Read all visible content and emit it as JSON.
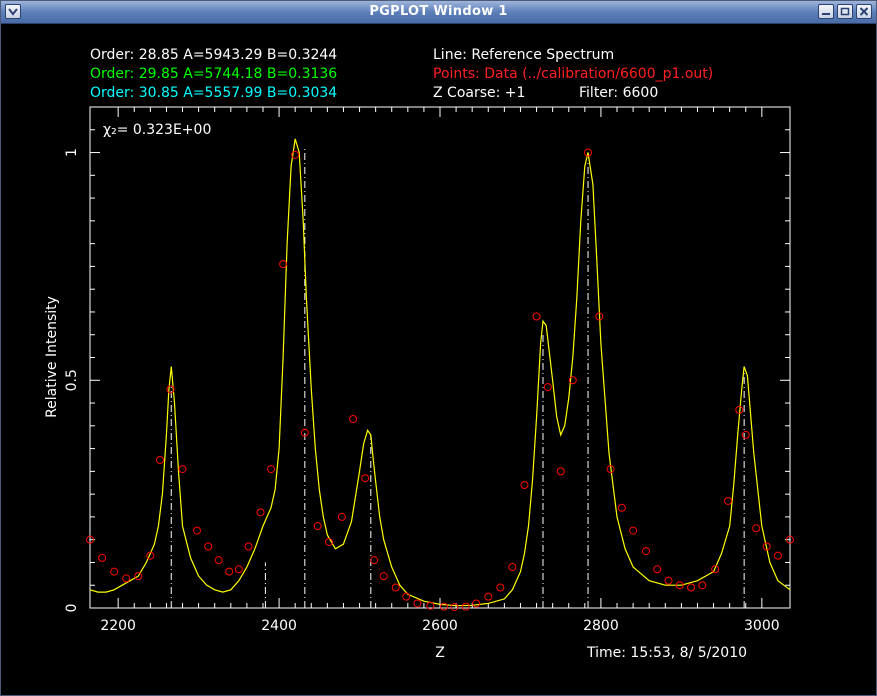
{
  "window": {
    "title": "PGPLOT Window 1",
    "menu_icon": "chevron-down-icon",
    "minimize_icon": "minimize-icon",
    "maximize_icon": "maximize-icon",
    "close_icon": "close-icon"
  },
  "header": {
    "orders": [
      {
        "text": "Order: 28.85 A=5943.29 B=0.3244",
        "color": "#ffffff"
      },
      {
        "text": "Order: 29.85 A=5744.18 B=0.3136",
        "color": "#00ff00"
      },
      {
        "text": "Order: 30.85 A=5557.99 B=0.3034",
        "color": "#00ffff"
      }
    ],
    "line_label": "Line: Reference Spectrum",
    "points_label": "Points: Data (../calibration/6600_p1.out)",
    "z_coarse": "Z Coarse: +1",
    "filter": "Filter: 6600",
    "time": "Time: 15:53,  8/ 5/2010"
  },
  "colors": {
    "background": "#000000",
    "axes": "#ffffff",
    "line": "#ffff00",
    "points": "#ff0000"
  },
  "chart_data": {
    "type": "line",
    "title": "",
    "xlabel": "Z",
    "ylabel": "Relative Intensity",
    "annotation": "χ₂=  0.323E+00",
    "xlim": [
      2165,
      3035
    ],
    "ylim": [
      0,
      1.1
    ],
    "x_ticks": [
      2200,
      2400,
      2600,
      2800,
      3000
    ],
    "y_ticks": [
      0,
      0.5,
      1
    ],
    "series": [
      {
        "name": "Reference Spectrum",
        "kind": "line",
        "color": "#ffff00",
        "x": [
          2165,
          2175,
          2185,
          2195,
          2205,
          2215,
          2225,
          2235,
          2245,
          2250,
          2255,
          2260,
          2263,
          2266,
          2270,
          2275,
          2280,
          2290,
          2300,
          2310,
          2320,
          2330,
          2340,
          2350,
          2360,
          2370,
          2380,
          2385,
          2390,
          2395,
          2400,
          2405,
          2410,
          2415,
          2420,
          2425,
          2430,
          2434,
          2440,
          2445,
          2450,
          2455,
          2460,
          2470,
          2480,
          2490,
          2500,
          2505,
          2510,
          2514,
          2518,
          2525,
          2530,
          2540,
          2550,
          2560,
          2580,
          2600,
          2620,
          2640,
          2660,
          2680,
          2690,
          2700,
          2705,
          2710,
          2715,
          2720,
          2725,
          2728,
          2732,
          2740,
          2745,
          2750,
          2755,
          2760,
          2765,
          2770,
          2775,
          2780,
          2784,
          2790,
          2795,
          2800,
          2810,
          2820,
          2830,
          2840,
          2860,
          2880,
          2900,
          2920,
          2940,
          2950,
          2960,
          2965,
          2970,
          2975,
          2978,
          2982,
          2990,
          3000,
          3010,
          3020,
          3035
        ],
        "y": [
          0.04,
          0.035,
          0.035,
          0.04,
          0.05,
          0.06,
          0.07,
          0.1,
          0.14,
          0.18,
          0.25,
          0.38,
          0.48,
          0.53,
          0.45,
          0.3,
          0.18,
          0.11,
          0.07,
          0.05,
          0.04,
          0.035,
          0.04,
          0.06,
          0.09,
          0.13,
          0.18,
          0.2,
          0.22,
          0.26,
          0.35,
          0.55,
          0.8,
          0.97,
          1.03,
          1.0,
          0.85,
          0.68,
          0.48,
          0.35,
          0.26,
          0.2,
          0.16,
          0.13,
          0.14,
          0.19,
          0.3,
          0.36,
          0.39,
          0.38,
          0.31,
          0.2,
          0.15,
          0.09,
          0.05,
          0.03,
          0.015,
          0.008,
          0.005,
          0.006,
          0.01,
          0.02,
          0.04,
          0.08,
          0.12,
          0.18,
          0.28,
          0.42,
          0.58,
          0.63,
          0.62,
          0.5,
          0.42,
          0.38,
          0.4,
          0.46,
          0.55,
          0.68,
          0.85,
          0.97,
          1.0,
          0.93,
          0.76,
          0.58,
          0.34,
          0.2,
          0.13,
          0.09,
          0.06,
          0.05,
          0.05,
          0.06,
          0.08,
          0.12,
          0.18,
          0.27,
          0.38,
          0.48,
          0.53,
          0.51,
          0.34,
          0.18,
          0.1,
          0.06,
          0.04
        ]
      },
      {
        "name": "Data",
        "kind": "points",
        "color": "#ff0000",
        "x": [
          2165,
          2180,
          2195,
          2210,
          2225,
          2240,
          2252,
          2265,
          2280,
          2298,
          2312,
          2325,
          2338,
          2350,
          2362,
          2377,
          2390,
          2405,
          2420,
          2432,
          2448,
          2462,
          2478,
          2492,
          2507,
          2518,
          2530,
          2545,
          2558,
          2572,
          2588,
          2605,
          2618,
          2632,
          2645,
          2660,
          2675,
          2690,
          2705,
          2720,
          2734,
          2750,
          2765,
          2784,
          2798,
          2812,
          2826,
          2840,
          2856,
          2870,
          2884,
          2898,
          2912,
          2926,
          2942,
          2958,
          2972,
          2980,
          2993,
          3006,
          3020,
          3035
        ],
        "y": [
          0.15,
          0.11,
          0.08,
          0.065,
          0.07,
          0.115,
          0.325,
          0.48,
          0.305,
          0.17,
          0.135,
          0.105,
          0.08,
          0.085,
          0.135,
          0.21,
          0.305,
          0.755,
          0.995,
          0.385,
          0.18,
          0.145,
          0.2,
          0.415,
          0.285,
          0.105,
          0.07,
          0.045,
          0.025,
          0.01,
          0.005,
          0.003,
          0.002,
          0.003,
          0.01,
          0.025,
          0.045,
          0.09,
          0.27,
          0.64,
          0.485,
          0.3,
          0.5,
          1.0,
          0.64,
          0.305,
          0.22,
          0.17,
          0.125,
          0.085,
          0.06,
          0.05,
          0.045,
          0.05,
          0.085,
          0.235,
          0.435,
          0.38,
          0.175,
          0.135,
          0.115,
          0.15
        ]
      }
    ],
    "vlines": [
      {
        "x": 2266,
        "h": 0.49
      },
      {
        "x": 2383,
        "h": 0.1
      },
      {
        "x": 2432,
        "h": 1.01
      },
      {
        "x": 2514,
        "h": 0.38
      },
      {
        "x": 2728,
        "h": 0.6
      },
      {
        "x": 2784,
        "h": 0.98
      },
      {
        "x": 2978,
        "h": 0.52
      }
    ]
  }
}
